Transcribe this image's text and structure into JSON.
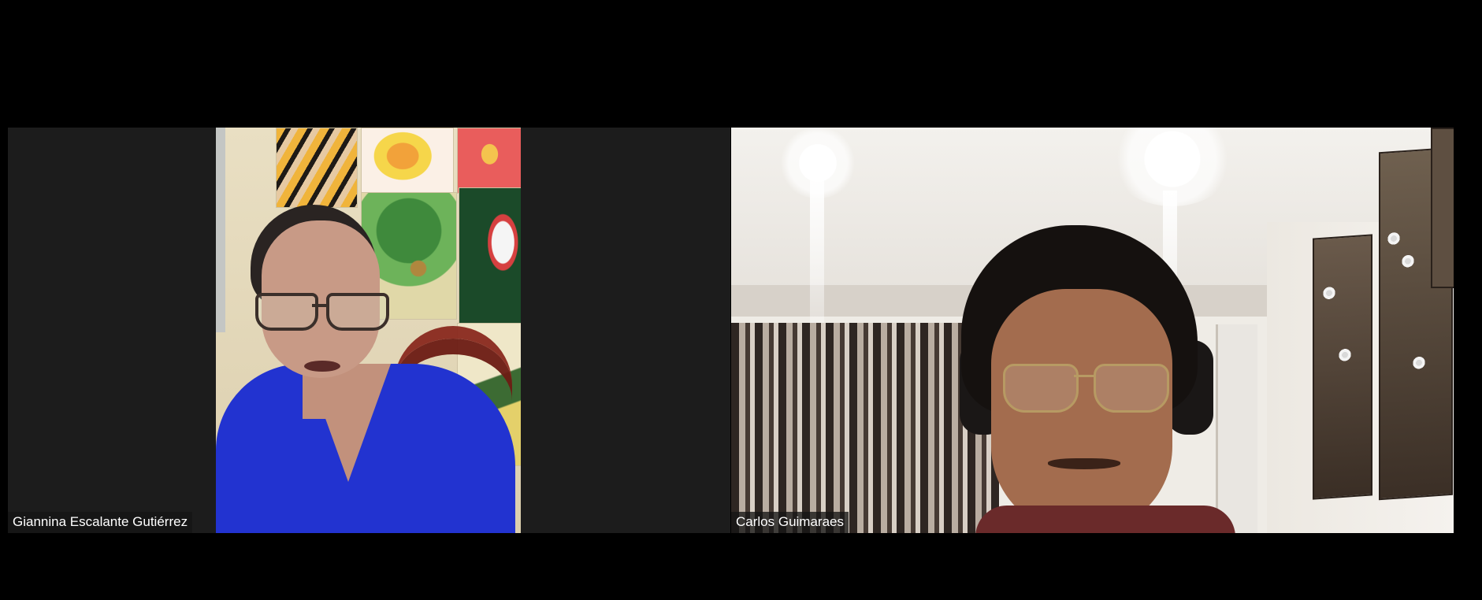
{
  "meeting": {
    "participants": [
      {
        "display_name": "Giannina Escalante Gutiérrez"
      },
      {
        "display_name": "Carlos Guimaraes"
      }
    ]
  },
  "colors": {
    "background": "#000000",
    "tile_background": "#1c1c1c",
    "label_background": "rgba(20,20,20,0.78)",
    "label_text": "#ffffff"
  }
}
